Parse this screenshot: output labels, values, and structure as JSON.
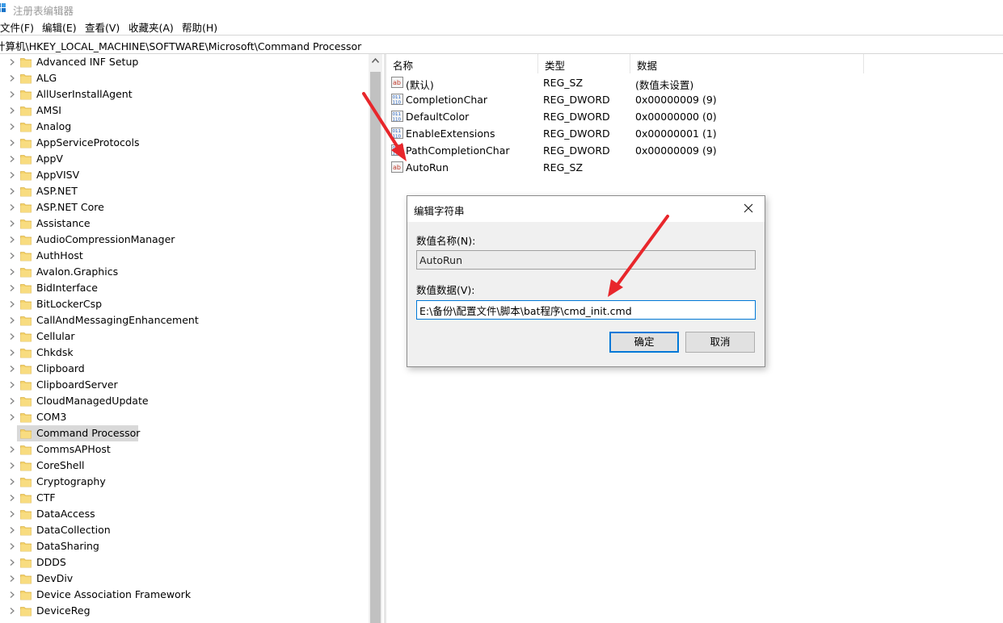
{
  "window": {
    "title": "注册表编辑器"
  },
  "menu": [
    "文件(F)",
    "编辑(E)",
    "查看(V)",
    "收藏夹(A)",
    "帮助(H)"
  ],
  "address": "计算机\\HKEY_LOCAL_MACHINE\\SOFTWARE\\Microsoft\\Command Processor",
  "tree": {
    "items": [
      "Advanced INF Setup",
      "ALG",
      "AllUserInstallAgent",
      "AMSI",
      "Analog",
      "AppServiceProtocols",
      "AppV",
      "AppVISV",
      "ASP.NET",
      "ASP.NET Core",
      "Assistance",
      "AudioCompressionManager",
      "AuthHost",
      "Avalon.Graphics",
      "BidInterface",
      "BitLockerCsp",
      "CallAndMessagingEnhancement",
      "Cellular",
      "Chkdsk",
      "Clipboard",
      "ClipboardServer",
      "CloudManagedUpdate",
      "COM3",
      "Command Processor",
      "CommsAPHost",
      "CoreShell",
      "Cryptography",
      "CTF",
      "DataAccess",
      "DataCollection",
      "DataSharing",
      "DDDS",
      "DevDiv",
      "Device Association Framework",
      "DeviceReg"
    ],
    "selected": "Command Processor"
  },
  "list": {
    "columns": {
      "name": "名称",
      "type": "类型",
      "data": "数据"
    },
    "rows": [
      {
        "icon": "string-value-icon",
        "name": "(默认)",
        "type": "REG_SZ",
        "data": "(数值未设置)"
      },
      {
        "icon": "binary-value-icon",
        "name": "CompletionChar",
        "type": "REG_DWORD",
        "data": "0x00000009 (9)"
      },
      {
        "icon": "binary-value-icon",
        "name": "DefaultColor",
        "type": "REG_DWORD",
        "data": "0x00000000 (0)"
      },
      {
        "icon": "binary-value-icon",
        "name": "EnableExtensions",
        "type": "REG_DWORD",
        "data": "0x00000001 (1)"
      },
      {
        "icon": "binary-value-icon",
        "name": "PathCompletionChar",
        "type": "REG_DWORD",
        "data": "0x00000009 (9)"
      },
      {
        "icon": "string-value-icon",
        "name": "AutoRun",
        "type": "REG_SZ",
        "data": ""
      }
    ]
  },
  "dialog": {
    "title": "编辑字符串",
    "name_label": "数值名称(N):",
    "name_value": "AutoRun",
    "data_label": "数值数据(V):",
    "data_value": "E:\\备份\\配置文件\\脚本\\bat程序\\cmd_init.cmd",
    "ok": "确定",
    "cancel": "取消"
  },
  "colors": {
    "accent": "#0078d7",
    "annotation_arrow": "#e8262b",
    "folder": "#f5d36b"
  }
}
